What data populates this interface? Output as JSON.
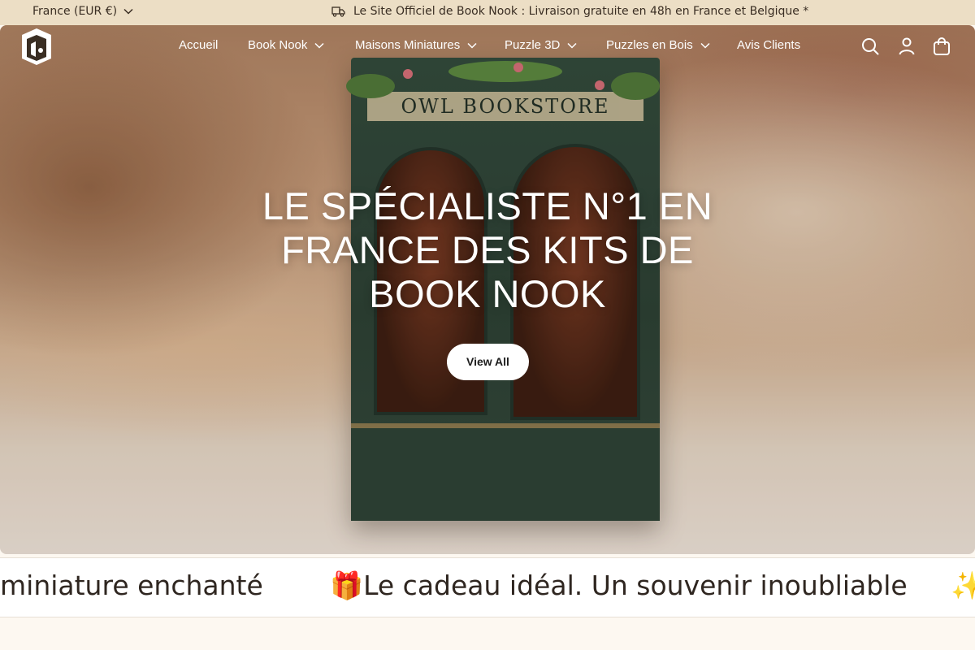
{
  "topbar": {
    "country_label": "France (EUR €)",
    "announcement": "Le Site Officiel de Book Nook : Livraison gratuite en 48h en France et Belgique *"
  },
  "header": {
    "logo_icon": "book-nook-logo-icon",
    "nav": [
      {
        "label": "Accueil",
        "has_dropdown": false
      },
      {
        "label": "Book Nook",
        "has_dropdown": true
      },
      {
        "label": "Maisons Miniatures",
        "has_dropdown": true
      },
      {
        "label": "Puzzle 3D",
        "has_dropdown": true
      },
      {
        "label": "Puzzles en Bois",
        "has_dropdown": true
      },
      {
        "label": "Avis Clients",
        "has_dropdown": false
      }
    ],
    "icons": [
      "search-icon",
      "account-icon",
      "cart-icon"
    ]
  },
  "hero": {
    "title": "LE SPÉCIALISTE N°1 EN FRANCE DES KITS DE BOOK NOOK",
    "cta_label": "View All",
    "image_sign_text": "OWL BOOKSTORE",
    "text_color": "#ffffff"
  },
  "marquee": {
    "items": [
      "miniature enchanté",
      "🎁Le cadeau idéal. Un souvenir inoubliable",
      "✨"
    ]
  },
  "colors": {
    "topbar_bg": "#ecdec5",
    "page_bg": "#fdf8f1",
    "text_dark": "#2f2620"
  }
}
